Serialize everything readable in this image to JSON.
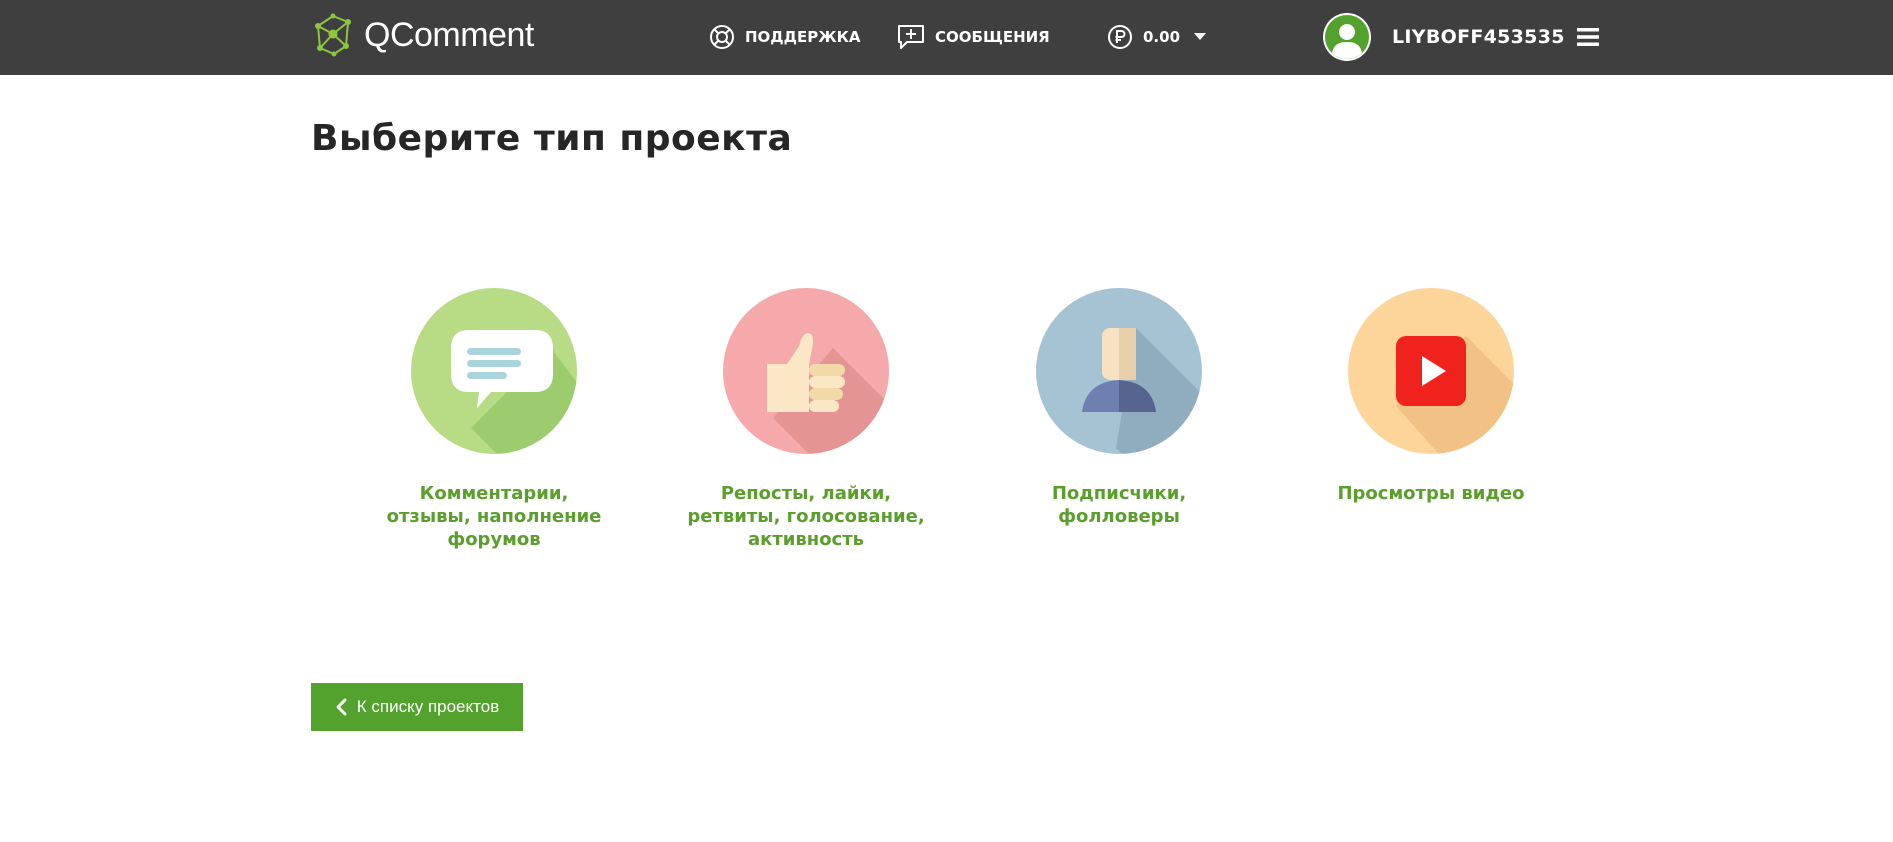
{
  "header": {
    "logo_text": "QComment",
    "nav": {
      "support_label": "ПОДДЕРЖКА",
      "messages_label": "СООБЩЕНИЯ",
      "balance_value": "0.00"
    },
    "user": {
      "username": "LIYBOFF453535"
    }
  },
  "main": {
    "title": "Выберите тип проекта",
    "project_types": [
      {
        "label": "Комментарии,\nотзывы, наполнение\nфорумов",
        "icon": "speech-bubble-icon"
      },
      {
        "label": "Репосты, лайки,\nретвиты, голосование,\nактивность",
        "icon": "thumbs-up-icon"
      },
      {
        "label": "Подписчики,\nфолловеры",
        "icon": "person-icon"
      },
      {
        "label": "Просмотры видео",
        "icon": "video-play-icon"
      }
    ],
    "back_button_label": "К списку проектов"
  },
  "colors": {
    "header_bg": "#3f3f3f",
    "accent_green": "#52a22d",
    "label_green": "#5a9e2c",
    "title": "#262626",
    "circle_green": "#b8dc86",
    "circle_pink": "#f6a9aa",
    "circle_blue": "#a6c3d4",
    "circle_orange": "#fdd59a",
    "video_red": "#f0221d"
  }
}
